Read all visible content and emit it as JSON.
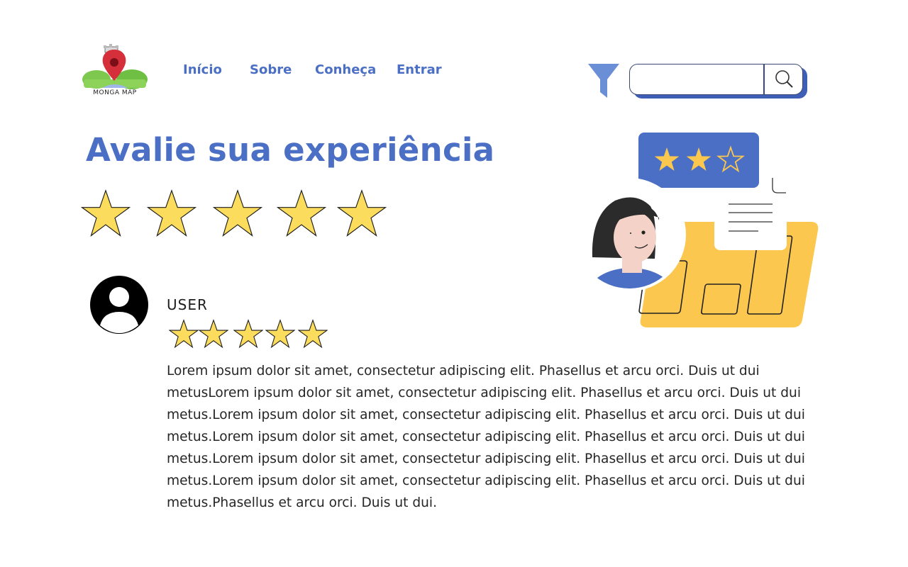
{
  "brand": {
    "logo_text": "MONGA MAP"
  },
  "nav": {
    "items": [
      {
        "label": "Início"
      },
      {
        "label": "Sobre"
      },
      {
        "label": "Conheça"
      },
      {
        "label": "Entrar"
      }
    ]
  },
  "search": {
    "value": "",
    "placeholder": ""
  },
  "icons": {
    "filter": "filter-icon",
    "search": "search-icon",
    "star": "star-icon",
    "avatar": "user-avatar-icon",
    "logo": "map-pin-logo"
  },
  "page": {
    "title": "Avalie sua experiência"
  },
  "rating_input": {
    "stars_filled": 5,
    "stars_max": 5
  },
  "illustration": {
    "stars_filled": 2,
    "stars_max": 3
  },
  "review": {
    "user": "USER",
    "stars_filled": 5,
    "stars_max": 5,
    "text": "Lorem ipsum dolor sit amet, consectetur adipiscing elit. Phasellus et arcu orci. Duis ut dui metusLorem ipsum dolor sit amet, consectetur adipiscing elit. Phasellus et arcu orci. Duis ut dui metus.Lorem ipsum dolor sit amet, consectetur adipiscing elit. Phasellus et arcu orci. Duis ut dui metus.Lorem ipsum dolor sit amet, consectetur adipiscing elit. Phasellus et arcu orci. Duis ut dui metus.Lorem ipsum dolor sit amet, consectetur adipiscing elit. Phasellus et arcu orci. Duis ut dui metus.Lorem ipsum dolor sit amet, consectetur adipiscing elit. Phasellus et arcu orci. Duis ut dui metus.Phasellus et arcu orci. Duis ut dui."
  },
  "colors": {
    "accent": "#4a6fc4",
    "star_fill": "#fcdc5c",
    "star_stroke": "#1a1a1a",
    "illustration_yellow": "#fcc74f",
    "illustration_blue": "#4a6fc4"
  }
}
